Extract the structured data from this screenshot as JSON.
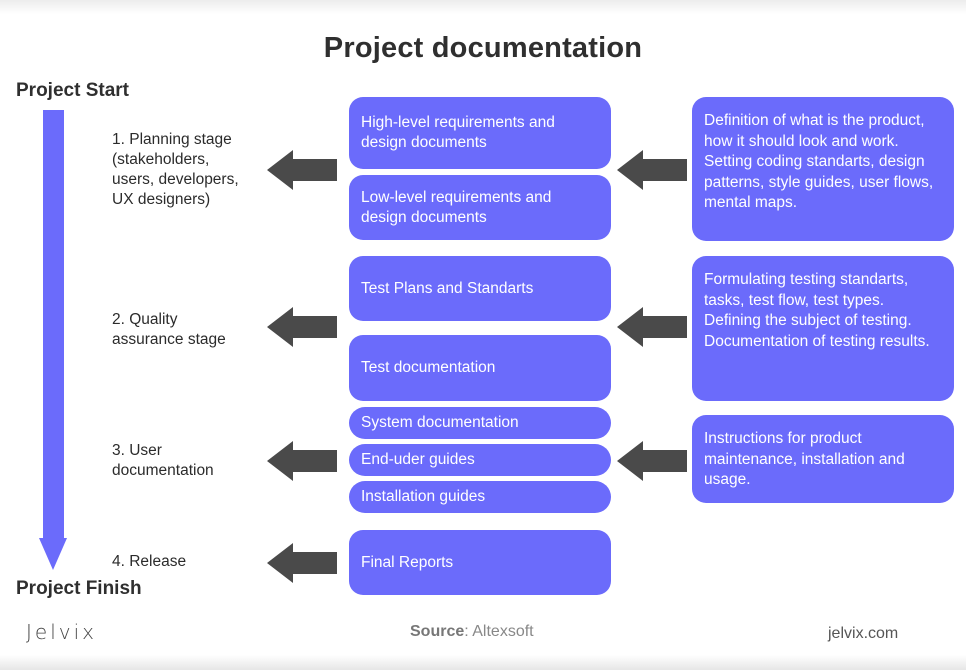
{
  "title": "Project documentation",
  "timeline": {
    "start_label": "Project Start",
    "finish_label": "Project Finish"
  },
  "stages": [
    {
      "label": "1. Planning stage\n(stakeholders,\nusers, developers,\nUX designers)",
      "documents": [
        "High-level requirements and design documents",
        "Low-level requirements and design documents"
      ],
      "description": "Definition of what is the product, how it should look and work. Setting coding standarts, design patterns, style guides, user flows, mental maps."
    },
    {
      "label": "2. Quality\nassurance stage",
      "documents": [
        "Test Plans and Standarts",
        "Test documentation"
      ],
      "description": "Formulating testing standarts, tasks, test flow, test types. Defining the subject of testing. Documentation of testing results."
    },
    {
      "label": "3. User\ndocumentation",
      "documents": [
        "System documentation",
        "End-uder guides",
        "Installation guides"
      ],
      "description": "Instructions for product maintenance, installation and usage."
    },
    {
      "label": "4. Release",
      "documents": [
        "Final Reports"
      ]
    }
  ],
  "footer": {
    "logo": "Jelvix",
    "source_label": "Source",
    "source_value": ": Altexsoft",
    "url": "jelvix.com"
  },
  "colors": {
    "accent": "#6b6bfb",
    "arrow": "#4a4a4a",
    "text": "#2b2b2b"
  }
}
